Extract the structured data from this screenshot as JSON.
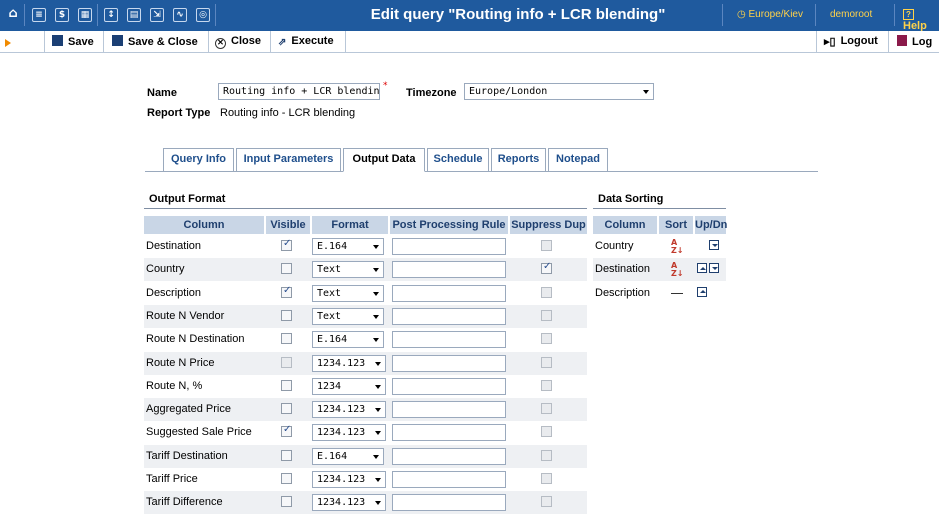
{
  "topbar": {
    "title": "Edit query \"Routing info + LCR blending\"",
    "timezone": "Europe/Kiev",
    "user": "demoroot",
    "help": "Help",
    "icons": [
      "home-icon",
      "list-icon",
      "dollar-icon",
      "grid-icon",
      "pin-icon",
      "map-icon",
      "folder-icon",
      "chart-icon",
      "search-icon"
    ]
  },
  "toolbar": {
    "save": "Save",
    "save_close": "Save & Close",
    "close": "Close",
    "execute": "Execute",
    "logout": "Logout",
    "log": "Log"
  },
  "form": {
    "name_label": "Name",
    "name_value": "Routing info + LCR blending",
    "timezone_label": "Timezone",
    "timezone_value": "Europe/London",
    "report_type_label": "Report Type",
    "report_type_value": "Routing info - LCR blending"
  },
  "tabs": [
    "Query Info",
    "Input Parameters",
    "Output Data",
    "Schedule",
    "Reports",
    "Notepad"
  ],
  "active_tab": "Output Data",
  "output_format": {
    "title": "Output Format",
    "headers": [
      "Column",
      "Visible",
      "Format",
      "Post Processing Rule",
      "Suppress Dup"
    ],
    "rows": [
      {
        "name": "Destination",
        "visible": true,
        "format": "E.164",
        "rule": "",
        "suppress": false
      },
      {
        "name": "Country",
        "visible": false,
        "format": "Text",
        "rule": "",
        "suppress": true
      },
      {
        "name": "Description",
        "visible": true,
        "format": "Text",
        "rule": "",
        "suppress": false
      },
      {
        "name": "Route N Vendor",
        "visible": false,
        "format": "Text",
        "rule": "",
        "suppress": false
      },
      {
        "name": "Route N Destination",
        "visible": false,
        "format": "E.164",
        "rule": "",
        "suppress": false
      },
      {
        "name": "Route N Price",
        "visible": false,
        "format": "1234.123",
        "rule": "",
        "suppress": false
      },
      {
        "name": "Route N, %",
        "visible": false,
        "format": "1234",
        "rule": "",
        "suppress": false
      },
      {
        "name": "Aggregated Price",
        "visible": false,
        "format": "1234.123",
        "rule": "",
        "suppress": false
      },
      {
        "name": "Suggested Sale Price",
        "visible": true,
        "format": "1234.123",
        "rule": "",
        "suppress": false
      },
      {
        "name": "Tariff Destination",
        "visible": false,
        "format": "E.164",
        "rule": "",
        "suppress": false
      },
      {
        "name": "Tariff Price",
        "visible": false,
        "format": "1234.123",
        "rule": "",
        "suppress": false
      },
      {
        "name": "Tariff Difference",
        "visible": false,
        "format": "1234.123",
        "rule": "",
        "suppress": false
      }
    ]
  },
  "data_sorting": {
    "title": "Data Sorting",
    "headers": [
      "Column",
      "Sort",
      "Up/Dn"
    ],
    "rows": [
      {
        "name": "Country",
        "sort": "asc",
        "up": false,
        "down": true
      },
      {
        "name": "Destination",
        "sort": "asc",
        "up": true,
        "down": true
      },
      {
        "name": "Description",
        "sort": "none",
        "up": true,
        "down": false
      }
    ]
  }
}
